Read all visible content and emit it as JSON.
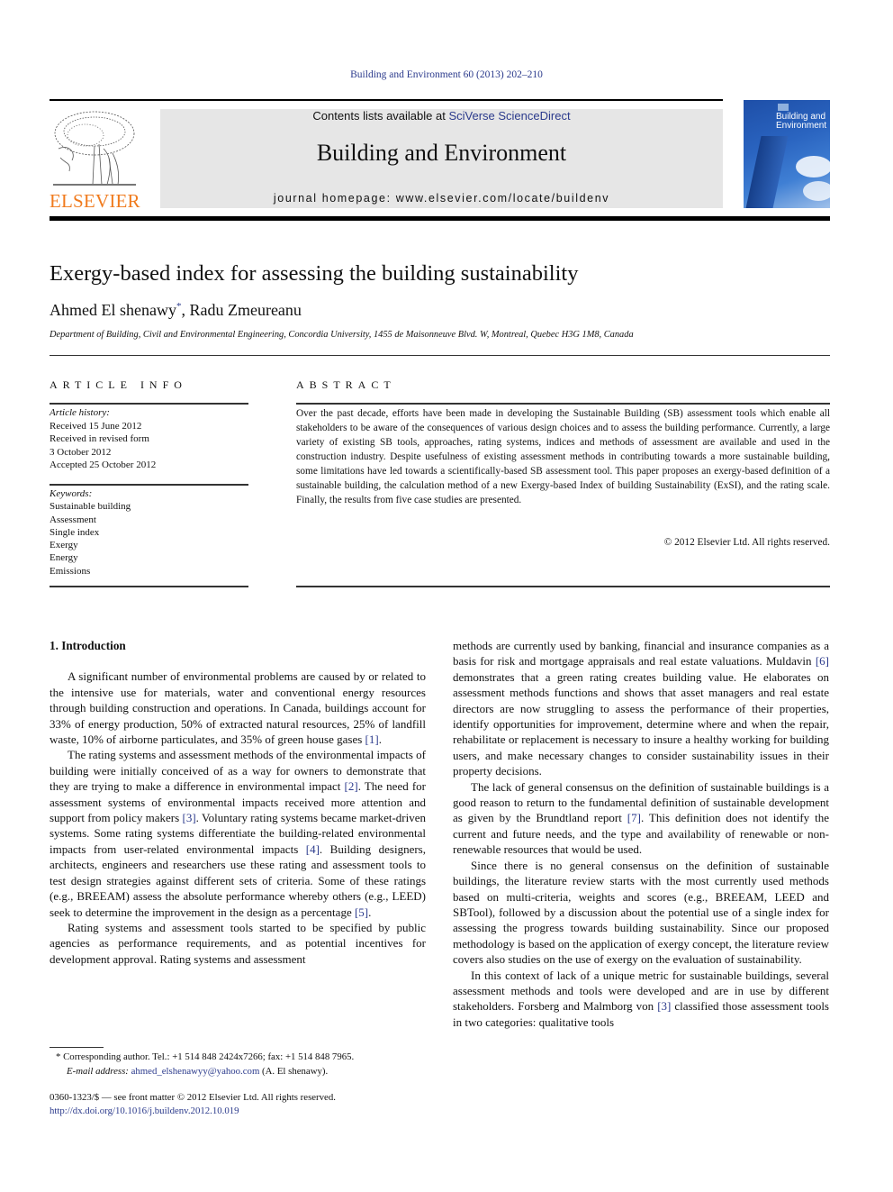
{
  "running_head": "Building and Environment 60 (2013) 202–210",
  "masthead": {
    "publisher_logo_text": "ELSEVIER",
    "contents_prefix": "Contents lists available at ",
    "contents_link": "SciVerse ScienceDirect",
    "journal_name": "Building and Environment",
    "homepage": "journal homepage: www.elsevier.com/locate/buildenv",
    "cover_title_line1": "Building and",
    "cover_title_line2": "Environment",
    "colors": {
      "logo_orange": "#f07b1e",
      "link_blue": "#2b3a8c",
      "masthead_gray": "#e6e6e6"
    }
  },
  "article": {
    "title": "Exergy-based index for assessing the building sustainability",
    "authors": [
      {
        "name": "Ahmed El shenawy",
        "mark": "*"
      },
      {
        "name": "Radu Zmeureanu",
        "mark": ""
      }
    ],
    "author_separator": ", ",
    "affiliation": "Department of Building, Civil and Environmental Engineering, Concordia University, 1455 de Maisonneuve Blvd. W, Montreal, Quebec H3G 1M8, Canada"
  },
  "article_info": {
    "heading": "ARTICLE INFO",
    "history_label": "Article history:",
    "history": [
      "Received 15 June 2012",
      "Received in revised form",
      "3 October 2012",
      "Accepted 25 October 2012"
    ],
    "keywords_label": "Keywords:",
    "keywords": [
      "Sustainable building",
      "Assessment",
      "Single index",
      "Exergy",
      "Energy",
      "Emissions"
    ]
  },
  "abstract": {
    "heading": "ABSTRACT",
    "text": "Over the past decade, efforts have been made in developing the Sustainable Building (SB) assessment tools which enable all stakeholders to be aware of the consequences of various design choices and to assess the building performance. Currently, a large variety of existing SB tools, approaches, rating systems, indices and methods of assessment are available and used in the construction industry. Despite usefulness of existing assessment methods in contributing towards a more sustainable building, some limitations have led towards a scientifically-based SB assessment tool. This paper proposes an exergy-based definition of a sustainable building, the calculation method of a new Exergy-based Index of building Sustainability (ExSI), and the rating scale. Finally, the results from five case studies are presented.",
    "copyright": "© 2012 Elsevier Ltd. All rights reserved."
  },
  "body": {
    "section_heading": "1.  Introduction",
    "left_paragraphs": [
      [
        {
          "t": "A significant number of environmental problems are caused by or related to the intensive use for materials, water and conventional energy resources through building construction and operations. In Canada, buildings account for 33% of energy production, 50% of extracted natural resources, 25% of landfill waste, 10% of airborne particulates, and 35% of green house gases "
        },
        {
          "ref": "[1]"
        },
        {
          "t": "."
        }
      ],
      [
        {
          "t": "The rating systems and assessment methods of the environmental impacts of building were initially conceived of as a way for owners to demonstrate that they are trying to make a difference in environmental impact "
        },
        {
          "ref": "[2]"
        },
        {
          "t": ". The need for assessment systems of environmental impacts received more attention and support from policy makers "
        },
        {
          "ref": "[3]"
        },
        {
          "t": ". Voluntary rating systems became market-driven systems. Some rating systems differentiate the building-related environmental impacts from user-related environmental impacts "
        },
        {
          "ref": "[4]"
        },
        {
          "t": ". Building designers, architects, engineers and researchers use these rating and assessment tools to test design strategies against different sets of criteria. Some of these ratings (e.g., BREEAM) assess the absolute performance whereby others (e.g., LEED) seek to determine the improvement in the design as a percentage "
        },
        {
          "ref": "[5]"
        },
        {
          "t": "."
        }
      ],
      [
        {
          "t": "Rating systems and assessment tools started to be specified by public agencies as performance requirements, and as potential incentives for development approval. Rating systems and assessment"
        }
      ]
    ],
    "right_paragraphs": [
      [
        {
          "t": "methods are currently used by banking, financial and insurance companies as a basis for risk and mortgage appraisals and real estate valuations. Muldavin "
        },
        {
          "ref": "[6]"
        },
        {
          "t": " demonstrates that a green rating creates building value. He elaborates on assessment methods functions and shows that asset managers and real estate directors are now struggling to assess the performance of their properties, identify opportunities for improvement, determine where and when the repair, rehabilitate or replacement is necessary to insure a healthy working for building users, and make necessary changes to consider sustainability issues in their property decisions."
        }
      ],
      [
        {
          "t": "The lack of general consensus on the definition of sustainable buildings is a good reason to return to the fundamental definition of sustainable development as given by the Brundtland report "
        },
        {
          "ref": "[7]"
        },
        {
          "t": ". This definition does not identify the current and future needs, and the type and availability of renewable or non-renewable resources that would be used."
        }
      ],
      [
        {
          "t": "Since there is no general consensus on the definition of sustainable buildings, the literature review starts with the most currently used methods based on multi-criteria, weights and scores (e.g., BREEAM, LEED and SBTool), followed by a discussion about the potential use of a single index for assessing the progress towards building sustainability. Since our proposed methodology is based on the application of exergy concept, the literature review covers also studies on the use of exergy on the evaluation of sustainability."
        }
      ],
      [
        {
          "t": "In this context of lack of a unique metric for sustainable buildings, several assessment methods and tools were developed and are in use by different stakeholders. Forsberg and Malmborg von "
        },
        {
          "ref": "[3]"
        },
        {
          "t": " classified those assessment tools in two categories: qualitative tools"
        }
      ]
    ]
  },
  "footnote": {
    "mark": "*",
    "corresponding": " Corresponding author. Tel.: +1 514 848 2424x7266; fax: +1 514 848 7965.",
    "email_label": "E-mail address: ",
    "email": "ahmed_elshenawyy@yahoo.com",
    "email_suffix": " (A. El shenawy)."
  },
  "front_matter": {
    "issn_line": "0360-1323/$ — see front matter © 2012 Elsevier Ltd. All rights reserved.",
    "doi": "http://dx.doi.org/10.1016/j.buildenv.2012.10.019"
  }
}
